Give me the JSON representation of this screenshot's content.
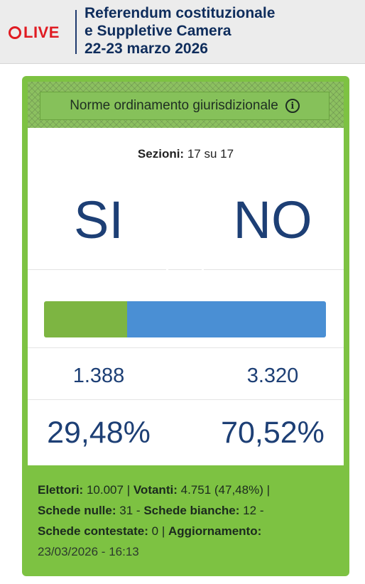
{
  "header": {
    "live_label": "LIVE",
    "title_lines": [
      "Referendum costituzionale",
      "e Suppletive Camera",
      "22-23 marzo 2026"
    ]
  },
  "card": {
    "topic": "Norme ordinamento giurisdizionale",
    "info_icon": "info-icon",
    "sezioni_label": "Sezioni:",
    "sezioni_value": "17 su 17",
    "si_label": "SI",
    "no_label": "NO",
    "si_share": 0.2948,
    "si_count": "1.388",
    "no_count": "3.320",
    "si_pct": "29,48%",
    "no_pct": "70,52%"
  },
  "stats": {
    "elettori_label": "Elettori:",
    "elettori_value": "10.007",
    "votanti_label": "Votanti:",
    "votanti_value": "4.751 (47,48%)",
    "nulle_label": "Schede nulle:",
    "nulle_value": "31",
    "bianche_label": "Schede bianche:",
    "bianche_value": "12",
    "contestate_label": "Schede contestate:",
    "contestate_value": "0",
    "aggiornamento_label": "Aggiornamento:",
    "aggiornamento_value": "23/03/2026 - 16:13"
  },
  "colors": {
    "accent_green": "#7dc242",
    "si_bar": "#7db542",
    "no_bar": "#4a8fd4",
    "title_navy": "#0f2d5c",
    "live_red": "#e01b22"
  }
}
